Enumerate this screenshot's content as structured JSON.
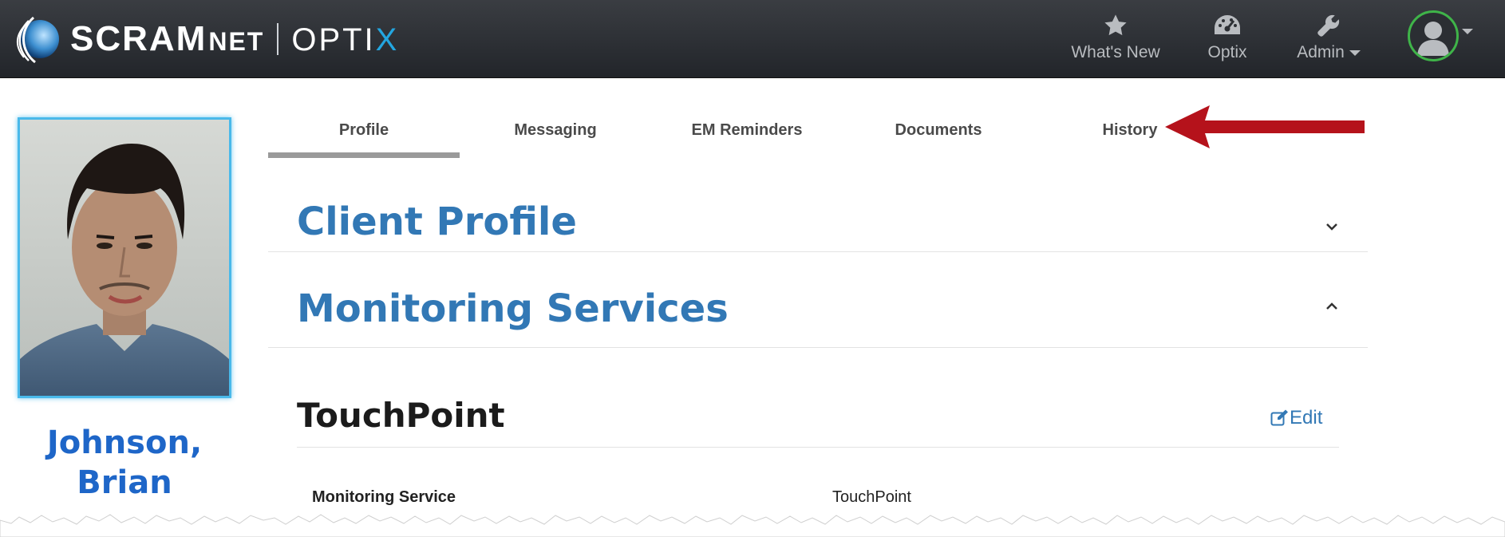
{
  "header": {
    "logo": {
      "brand": "SCRAM",
      "brand_suffix": "NET",
      "product": "OPTI",
      "product_x": "X"
    },
    "nav": [
      {
        "label": "What's New",
        "icon": "star-icon"
      },
      {
        "label": "Optix",
        "icon": "dashboard-gauge-icon"
      },
      {
        "label": "Admin",
        "icon": "wrench-icon",
        "dropdown": true
      }
    ],
    "user_menu": {
      "icon": "user-avatar-icon",
      "dropdown": true
    }
  },
  "client": {
    "name_line1": "Johnson,",
    "name_line2": "Brian"
  },
  "tabs": [
    {
      "label": "Profile",
      "active": true
    },
    {
      "label": "Messaging",
      "active": false
    },
    {
      "label": "EM Reminders",
      "active": false
    },
    {
      "label": "Documents",
      "active": false
    },
    {
      "label": "History",
      "active": false
    }
  ],
  "sections": {
    "client_profile": {
      "title": "Client Profile",
      "state": "collapsed"
    },
    "monitoring_services": {
      "title": "Monitoring Services",
      "state": "expanded"
    }
  },
  "service": {
    "title": "TouchPoint",
    "edit_label": "Edit",
    "fields": [
      {
        "label": "Monitoring Service",
        "value": "TouchPoint"
      }
    ]
  },
  "colors": {
    "header_bg": "#2d3035",
    "accent_blue": "#3278b5",
    "name_blue": "#1e66c8",
    "arrow_red": "#b5121b",
    "avatar_ring": "#3fb449"
  }
}
